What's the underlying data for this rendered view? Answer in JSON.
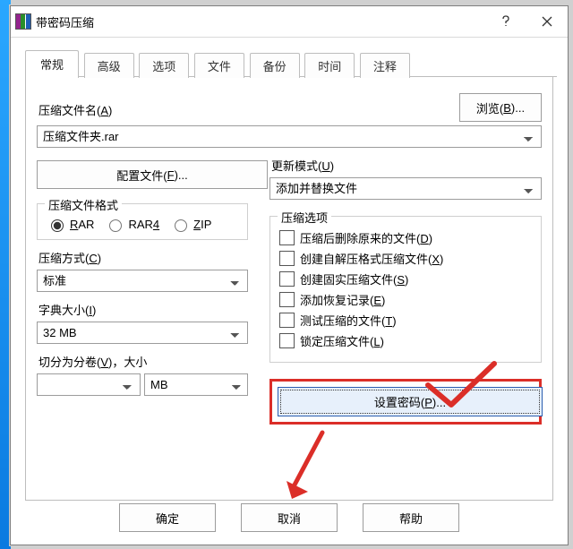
{
  "title": "带密码压缩",
  "tabs": [
    "常规",
    "高级",
    "选项",
    "文件",
    "备份",
    "时间",
    "注释"
  ],
  "active_tab": 0,
  "filename_label_pre": "压缩文件名(",
  "filename_label_key": "A",
  "filename_label_post": ")",
  "browse_pre": "浏览(",
  "browse_key": "B",
  "browse_post": ")...",
  "filename_value": "压缩文件夹.rar",
  "update_label_pre": "更新模式(",
  "update_label_key": "U",
  "update_label_post": ")",
  "update_value": "添加并替换文件",
  "profiles_pre": "配置文件(",
  "profiles_key": "F",
  "profiles_post": ")...",
  "format_legend": "压缩文件格式",
  "fmt_rar_pre": "R",
  "fmt_rar_post": "AR",
  "fmt_rar4_pre": "RAR",
  "fmt_rar4_key": "4",
  "fmt_zip_key": "Z",
  "fmt_zip_post": "IP",
  "method_label_pre": "压缩方式(",
  "method_label_key": "C",
  "method_label_post": ")",
  "method_value": "标准",
  "dict_label_pre": "字典大小(",
  "dict_label_key": "I",
  "dict_label_post": ")",
  "dict_value": "32 MB",
  "split_label_pre": "切分为分卷(",
  "split_label_key": "V",
  "split_label_post": ")，大小",
  "split_unit": "MB",
  "options_legend": "压缩选项",
  "opts": [
    {
      "pre": "压缩后删除原来的文件(",
      "key": "D",
      "post": ")"
    },
    {
      "pre": "创建自解压格式压缩文件(",
      "key": "X",
      "post": ")"
    },
    {
      "pre": "创建固实压缩文件(",
      "key": "S",
      "post": ")"
    },
    {
      "pre": "添加恢复记录(",
      "key": "E",
      "post": ")"
    },
    {
      "pre": "测试压缩的文件(",
      "key": "T",
      "post": ")"
    },
    {
      "pre": "锁定压缩文件(",
      "key": "L",
      "post": ")"
    }
  ],
  "password_pre": "设置密码(",
  "password_key": "P",
  "password_post": ")...",
  "btn_ok": "确定",
  "btn_cancel": "取消",
  "btn_help": "帮助"
}
